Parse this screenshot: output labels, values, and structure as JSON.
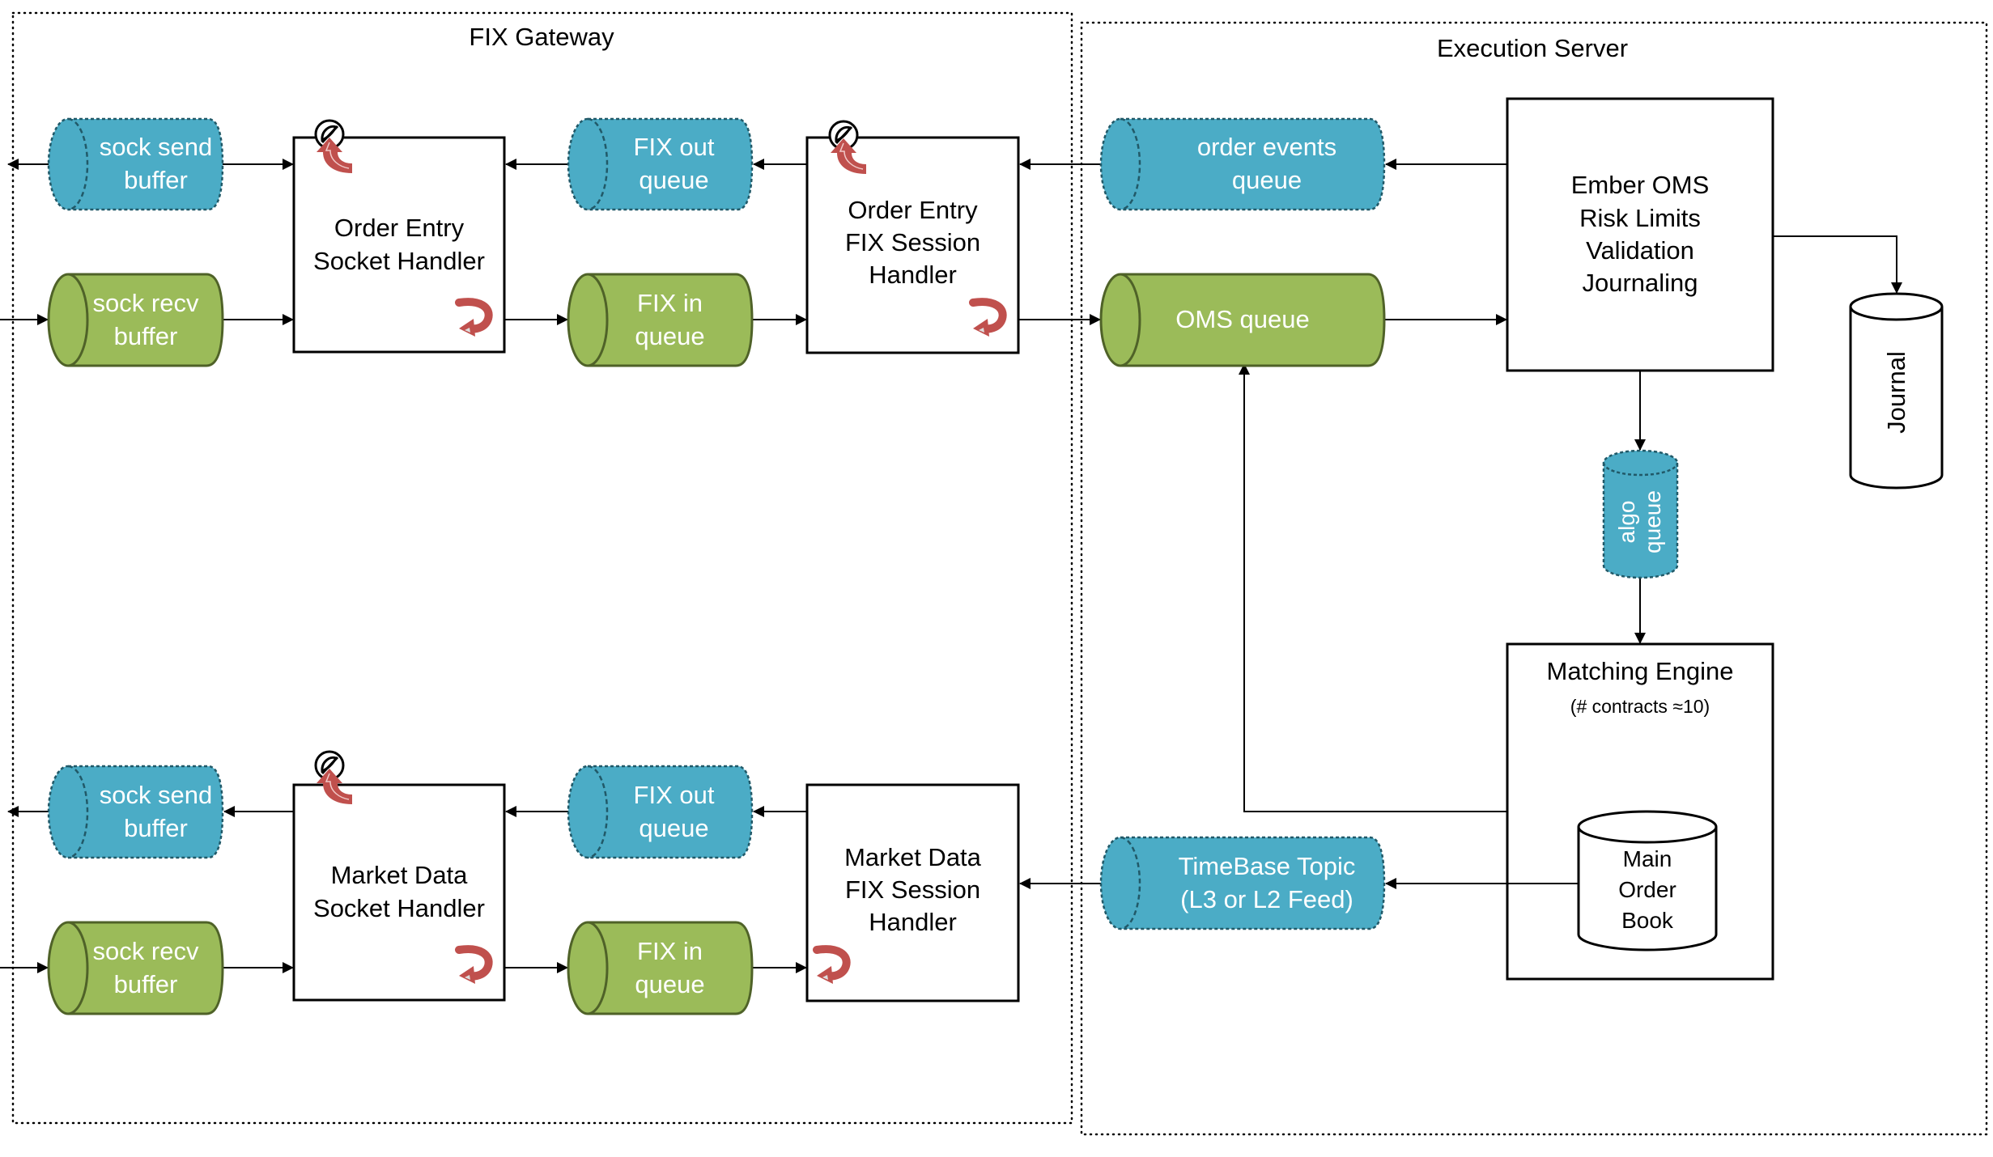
{
  "colors": {
    "queue_out_fill": "#4BACC6",
    "queue_out_stroke": "#215968",
    "queue_in_fill": "#9BBB59",
    "queue_in_stroke": "#4F6228",
    "icon_red": "#C0504D"
  },
  "groups": {
    "fix_gateway": {
      "title": "FIX Gateway"
    },
    "execution_server": {
      "title": "Execution Server"
    }
  },
  "order_entry": {
    "sock_send_buffer": [
      "sock send",
      "buffer"
    ],
    "sock_recv_buffer": [
      "sock recv",
      "buffer"
    ],
    "socket_handler": [
      "Order Entry",
      "Socket Handler"
    ],
    "fix_out_queue": [
      "FIX out",
      "queue"
    ],
    "fix_in_queue": [
      "FIX in",
      "queue"
    ],
    "fix_session_handler": [
      "Order Entry",
      "FIX Session",
      "Handler"
    ]
  },
  "market_data": {
    "sock_send_buffer": [
      "sock send",
      "buffer"
    ],
    "sock_recv_buffer": [
      "sock recv",
      "buffer"
    ],
    "socket_handler": [
      "Market Data",
      "Socket Handler"
    ],
    "fix_out_queue": [
      "FIX out",
      "queue"
    ],
    "fix_in_queue": [
      "FIX in",
      "queue"
    ],
    "fix_session_handler": [
      "Market Data",
      "FIX Session",
      "Handler"
    ]
  },
  "execution": {
    "order_events_queue": [
      "order events",
      "queue"
    ],
    "oms_queue": "OMS queue",
    "ember_oms": [
      "Ember OMS",
      "Risk Limits",
      "Validation",
      "Journaling"
    ],
    "journal": "Journal",
    "algo_queue": [
      "algo",
      "queue"
    ],
    "matching_engine": "Matching Engine",
    "matching_engine_note": "(# contracts ≈10)",
    "main_order_book": [
      "Main",
      "Order",
      "Book"
    ],
    "timebase_topic": [
      "TimeBase Topic",
      "(L3 or L2 Feed)"
    ]
  },
  "icons": {
    "idle_strategy": "idle-icon",
    "loop": "loop-arrow-icon"
  }
}
